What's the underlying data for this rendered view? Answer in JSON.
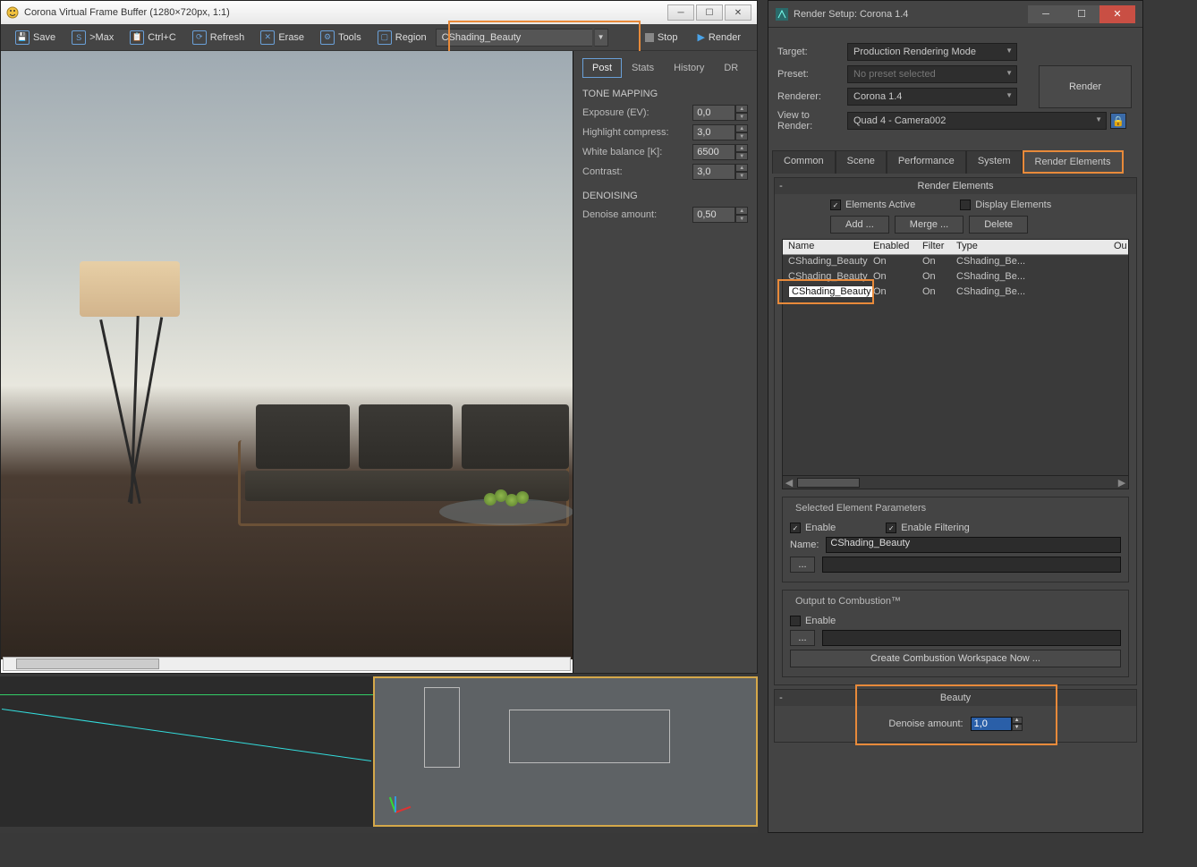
{
  "vfb": {
    "title": "Corona Virtual Frame Buffer (1280×720px, 1:1)",
    "toolbar": {
      "save": "Save",
      "max": ">Max",
      "ctrlc": "Ctrl+C",
      "refresh": "Refresh",
      "erase": "Erase",
      "tools": "Tools",
      "region": "Region",
      "pass": "CShading_Beauty",
      "stop": "Stop",
      "render": "Render"
    },
    "tabs": {
      "post": "Post",
      "stats": "Stats",
      "history": "History",
      "dr": "DR"
    },
    "tone": {
      "heading": "TONE MAPPING",
      "exposure_l": "Exposure (EV):",
      "exposure_v": "0,0",
      "hcomp_l": "Highlight compress:",
      "hcomp_v": "3,0",
      "wb_l": "White balance [K]:",
      "wb_v": "6500",
      "contrast_l": "Contrast:",
      "contrast_v": "3,0"
    },
    "denoise": {
      "heading": "DENOISING",
      "amount_l": "Denoise amount:",
      "amount_v": "0,50"
    }
  },
  "rs": {
    "title": "Render Setup: Corona 1.4",
    "target_l": "Target:",
    "target_v": "Production Rendering Mode",
    "preset_l": "Preset:",
    "preset_v": "No preset selected",
    "renderer_l": "Renderer:",
    "renderer_v": "Corona 1.4",
    "view_l": "View to Render:",
    "view_v": "Quad 4 - Camera002",
    "render_btn": "Render",
    "tabs": {
      "common": "Common",
      "scene": "Scene",
      "perf": "Performance",
      "system": "System",
      "re": "Render Elements"
    },
    "re": {
      "heading": "Render Elements",
      "elements_active": "Elements Active",
      "display_elements": "Display Elements",
      "add": "Add ...",
      "merge": "Merge ...",
      "delete": "Delete",
      "cols": {
        "name": "Name",
        "enabled": "Enabled",
        "filter": "Filter",
        "type": "Type",
        "out": "Ou"
      },
      "rows": [
        {
          "name": "CShading_Beauty",
          "enabled": "On",
          "filter": "On",
          "type": "CShading_Be..."
        },
        {
          "name": "CShading_Beauty",
          "enabled": "On",
          "filter": "On",
          "type": "CShading_Be..."
        },
        {
          "name": "CShading_Beauty",
          "enabled": "On",
          "filter": "On",
          "type": "CShading_Be..."
        }
      ]
    },
    "sep": {
      "heading": "Selected Element Parameters",
      "enable": "Enable",
      "enable_filtering": "Enable Filtering",
      "name_l": "Name:",
      "name_v": "CShading_Beauty"
    },
    "comb": {
      "heading": "Output to Combustion™",
      "enable": "Enable",
      "create": "Create Combustion Workspace Now ..."
    },
    "beauty": {
      "heading": "Beauty",
      "denoise_l": "Denoise amount:",
      "denoise_v": "1,0"
    }
  }
}
